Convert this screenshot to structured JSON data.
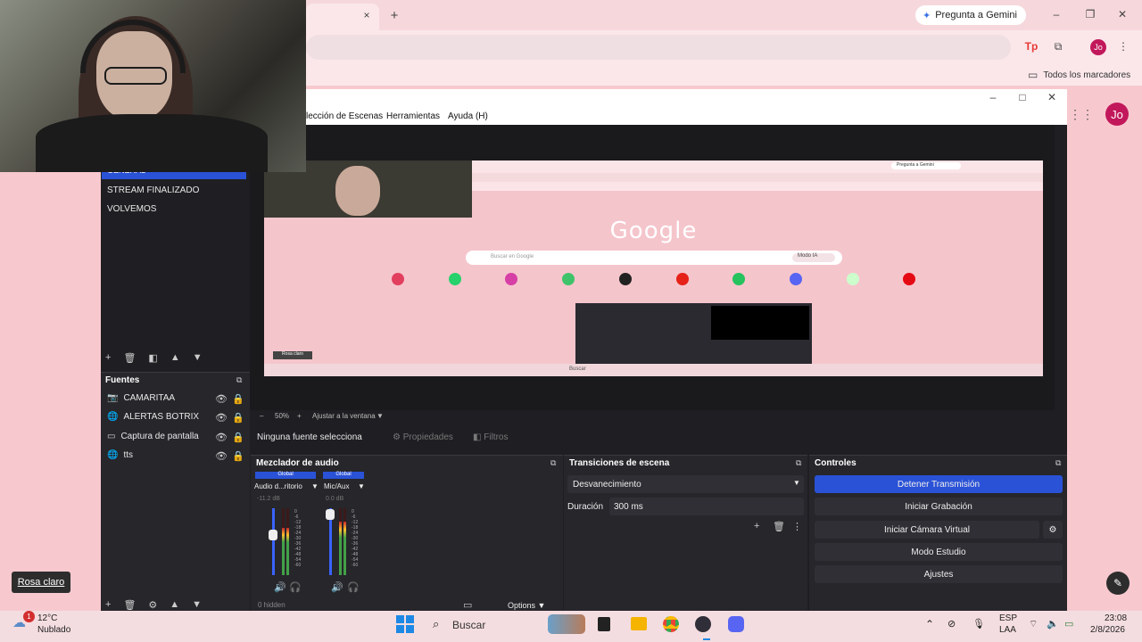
{
  "chrome": {
    "gemini_label": "Pregunta a Gemini",
    "bookmarks_label": "Todos los marcadores",
    "profile_initials": "Jo",
    "new_tab_symbol": "+",
    "close_tab_symbol": "×"
  },
  "obs": {
    "menu": [
      "lección de Escenas",
      "Herramientas",
      "Ayuda (H)"
    ],
    "scenes": [
      "GENERAL",
      "STREAM FINALIZADO",
      "VOLVEMOS"
    ],
    "sources_title": "Fuentes",
    "sources": [
      "CAMARITAA",
      "ALERTAS BOTRIX",
      "Captura de pantalla",
      "tts"
    ],
    "no_source_selected": "Ninguna fuente selecciona",
    "properties_label": "Propiedades",
    "filters_label": "Filtros",
    "preview_canvas": {
      "google_logo": "Google",
      "search_placeholder": "Buscar en Google",
      "gemini_chip": "Pregunta a Gemini",
      "mode_chip": "Modo IA",
      "bottom_badge": "Rosa claro",
      "taskbar_search": "Buscar"
    },
    "preview_status": {
      "zoom": "50%",
      "fit": "Ajustar a la ventana"
    },
    "mixer": {
      "title": "Mezclador de audio",
      "channels": [
        {
          "tag": "Global",
          "name": "Audio d...ritorio",
          "db": "-11.2 dB",
          "level": 0.7
        },
        {
          "tag": "Global",
          "name": "Mic/Aux",
          "db": "0.0 dB",
          "level": 0.8
        }
      ],
      "scale": [
        "0",
        "-6",
        "-12",
        "-18",
        "-24",
        "-30",
        "-36",
        "-42",
        "-48",
        "-54",
        "-60"
      ],
      "hidden_count": "0 hidden",
      "options_label": "Options"
    },
    "transitions": {
      "title": "Transiciones de escena",
      "selected": "Desvanecimiento",
      "duration_label": "Duración",
      "duration_value": "300 ms"
    },
    "controls": {
      "title": "Controles",
      "stop_stream": "Detener Transmisión",
      "start_recording": "Iniciar Grabación",
      "start_virtual_cam": "Iniciar Cámara Virtual",
      "studio_mode": "Modo Estudio",
      "settings": "Ajustes"
    }
  },
  "overlay": {
    "theme_badge": "Rosa claro"
  },
  "taskbar": {
    "weather_temp": "12°C",
    "weather_desc": "Nublado",
    "weather_badge": "1",
    "search_label": "Buscar",
    "lang_top": "ESP",
    "lang_bottom": "LAA",
    "time": "23:08",
    "date": "2/8/2026"
  },
  "colors": {
    "obs_accent": "#2a52d6",
    "page_pink": "#f7c9cf",
    "profile": "#c2185b"
  }
}
